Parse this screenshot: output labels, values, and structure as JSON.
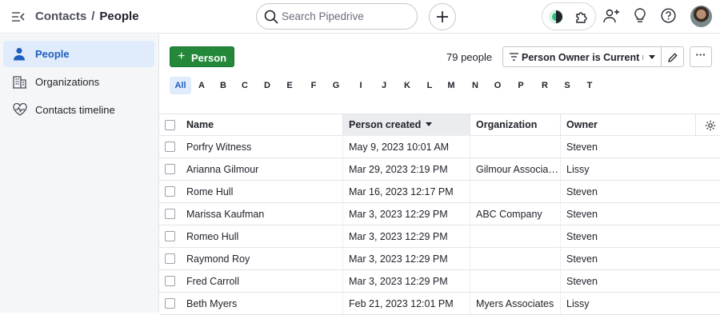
{
  "breadcrumb": {
    "parent": "Contacts",
    "separator": "/",
    "current": "People"
  },
  "search": {
    "placeholder": "Search Pipedrive"
  },
  "sidebar": {
    "items": [
      {
        "label": "People",
        "icon": "person-icon",
        "active": true
      },
      {
        "label": "Organizations",
        "icon": "building-icon",
        "active": false
      },
      {
        "label": "Contacts timeline",
        "icon": "heart-pulse-icon",
        "active": false
      }
    ]
  },
  "toolbar": {
    "add_label": "Person",
    "count": "79 people",
    "filter_label": "Person Owner is Current user",
    "more_label": "···"
  },
  "alphabet": [
    "All",
    "A",
    "B",
    "C",
    "D",
    "E",
    "F",
    "G",
    "I",
    "J",
    "K",
    "L",
    "M",
    "N",
    "O",
    "P",
    "R",
    "S",
    "T"
  ],
  "table": {
    "columns": [
      "Name",
      "Person created",
      "Organization",
      "Owner"
    ],
    "sorted_column": "Person created",
    "rows": [
      {
        "name": "Porfry Witness",
        "created": "May 9, 2023 10:01 AM",
        "org": "",
        "owner": "Steven"
      },
      {
        "name": "Arianna Gilmour",
        "created": "Mar 29, 2023 2:19 PM",
        "org": "Gilmour Associates",
        "owner": "Lissy"
      },
      {
        "name": "Rome Hull",
        "created": "Mar 16, 2023 12:17 PM",
        "org": "",
        "owner": "Steven"
      },
      {
        "name": "Marissa Kaufman",
        "created": "Mar 3, 2023 12:29 PM",
        "org": "ABC Company",
        "owner": "Steven"
      },
      {
        "name": "Romeo Hull",
        "created": "Mar 3, 2023 12:29 PM",
        "org": "",
        "owner": "Steven"
      },
      {
        "name": "Raymond Roy",
        "created": "Mar 3, 2023 12:29 PM",
        "org": "",
        "owner": "Steven"
      },
      {
        "name": "Fred Carroll",
        "created": "Mar 3, 2023 12:29 PM",
        "org": "",
        "owner": "Steven"
      },
      {
        "name": "Beth Myers",
        "created": "Feb 21, 2023 12:01 PM",
        "org": "Myers Associates",
        "owner": "Lissy"
      }
    ]
  },
  "colors": {
    "accent_green": "#24883a",
    "active_blue": "#1f5fbf",
    "active_bg": "#e0ecfb"
  }
}
